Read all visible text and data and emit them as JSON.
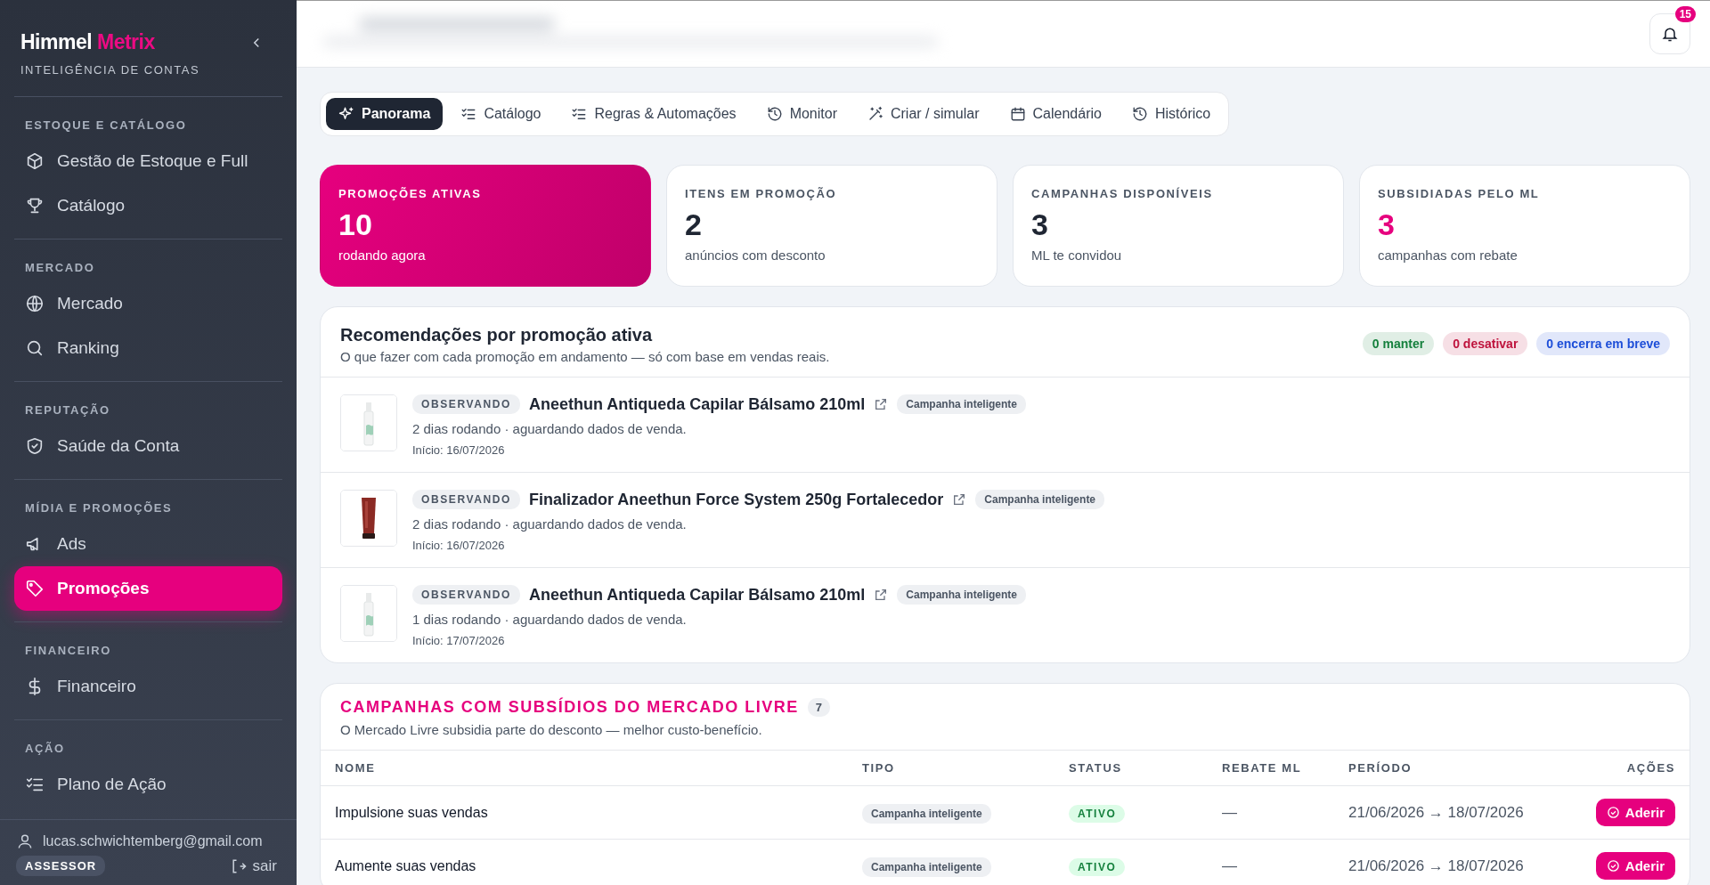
{
  "sidebar": {
    "brand": {
      "first": "Himmel",
      "second": "Metrix"
    },
    "subtitle": "INTELIGÊNCIA DE CONTAS",
    "sections": [
      {
        "title": "ESTOQUE E CATÁLOGO",
        "items": [
          {
            "label": "Gestão de Estoque e Full",
            "selected": false
          },
          {
            "label": "Catálogo",
            "selected": false
          }
        ]
      },
      {
        "title": "MERCADO",
        "items": [
          {
            "label": "Mercado",
            "selected": false
          },
          {
            "label": "Ranking",
            "selected": false
          }
        ]
      },
      {
        "title": "REPUTAÇÃO",
        "items": [
          {
            "label": "Saúde da Conta",
            "selected": false
          }
        ]
      },
      {
        "title": "MÍDIA E PROMOÇÕES",
        "items": [
          {
            "label": "Ads",
            "selected": false
          },
          {
            "label": "Promoções",
            "selected": true
          }
        ]
      },
      {
        "title": "FINANCEIRO",
        "items": [
          {
            "label": "Financeiro",
            "selected": false
          }
        ]
      },
      {
        "title": "AÇÃO",
        "items": [
          {
            "label": "Plano de Ação",
            "selected": false
          }
        ]
      }
    ],
    "user": {
      "email": "lucas.schwichtemberg@gmail.com",
      "role": "ASSESSOR",
      "logout": "sair"
    }
  },
  "header": {
    "notifications": "15"
  },
  "tabs": [
    {
      "label": "Panorama",
      "selected": true
    },
    {
      "label": "Catálogo",
      "selected": false
    },
    {
      "label": "Regras & Automações",
      "selected": false
    },
    {
      "label": "Monitor",
      "selected": false
    },
    {
      "label": "Criar / simular",
      "selected": false
    },
    {
      "label": "Calendário",
      "selected": false
    },
    {
      "label": "Histórico",
      "selected": false
    }
  ],
  "stats": [
    {
      "title": "PROMOÇÕES ATIVAS",
      "value": "10",
      "caption": "rodando agora",
      "kind": "highlight"
    },
    {
      "title": "ITENS EM PROMOÇÃO",
      "value": "2",
      "caption": "anúncios com desconto",
      "kind": "plain"
    },
    {
      "title": "CAMPANHAS DISPONÍVEIS",
      "value": "3",
      "caption": "ML te convidou",
      "kind": "plain"
    },
    {
      "title": "SUBSIDIADAS PELO ML",
      "value": "3",
      "caption": "campanhas com rebate",
      "kind": "accent"
    }
  ],
  "recommendations": {
    "title": "Recomendações por promoção ativa",
    "subtitle": "O que fazer com cada promoção em andamento — só com base em vendas reais.",
    "pills": [
      {
        "label": "0 manter",
        "color": "#15803d"
      },
      {
        "label": "0 desativar",
        "color": "#be123c"
      },
      {
        "label": "0 encerra em breve",
        "color": "#1d4ed8"
      }
    ],
    "items": [
      {
        "status": "OBSERVANDO",
        "name": "Aneethun Antiqueda Capilar Bálsamo 210ml",
        "tag": "Campanha inteligente",
        "detail": "2 dias rodando · aguardando dados de venda.",
        "start": "Início: 16/07/2026"
      },
      {
        "status": "OBSERVANDO",
        "name": "Finalizador Aneethun Force System 250g Fortalecedor",
        "tag": "Campanha inteligente",
        "detail": "2 dias rodando · aguardando dados de venda.",
        "start": "Início: 16/07/2026"
      },
      {
        "status": "OBSERVANDO",
        "name": "Aneethun Antiqueda Capilar Bálsamo 210ml",
        "tag": "Campanha inteligente",
        "detail": "1 dias rodando · aguardando dados de venda.",
        "start": "Início: 17/07/2026"
      }
    ]
  },
  "campaigns": {
    "title": "CAMPANHAS COM SUBSÍDIOS DO MERCADO LIVRE",
    "count": "7",
    "subtitle": "O Mercado Livre subsidia parte do desconto — melhor custo-benefício.",
    "columns": [
      "NOME",
      "TIPO",
      "STATUS",
      "REBATE ML",
      "PERÍODO",
      "AÇÕES"
    ],
    "rows": [
      {
        "name": "Impulsione suas vendas",
        "type": "Campanha inteligente",
        "status": "ATIVO",
        "rebate": "—",
        "period": "21/06/2026 → 18/07/2026",
        "action": "Aderir"
      },
      {
        "name": "Aumente suas vendas",
        "type": "Campanha inteligente",
        "status": "ATIVO",
        "rebate": "—",
        "period": "21/06/2026 → 18/07/2026",
        "action": "Aderir"
      }
    ]
  }
}
